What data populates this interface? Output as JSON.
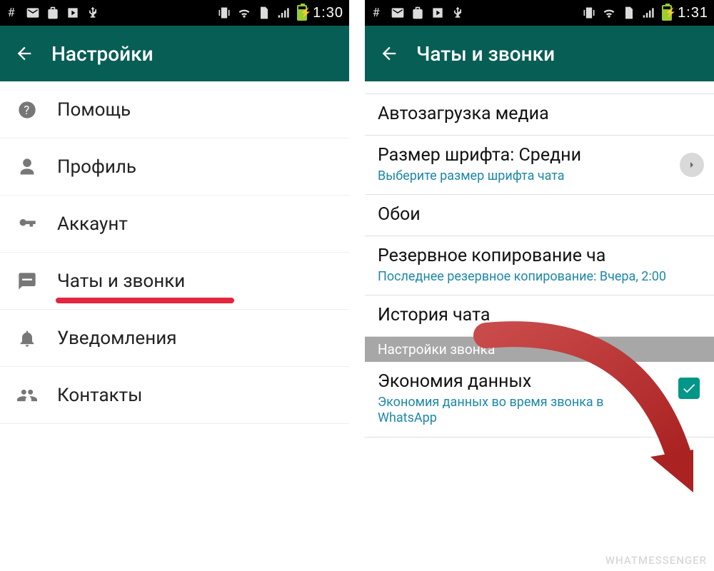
{
  "left": {
    "status": {
      "time": "1:30"
    },
    "appbar": {
      "title": "Настройки"
    },
    "items": [
      {
        "label": "Помощь"
      },
      {
        "label": "Профиль"
      },
      {
        "label": "Аккаунт"
      },
      {
        "label": "Чаты и звонки"
      },
      {
        "label": "Уведомления"
      },
      {
        "label": "Контакты"
      }
    ]
  },
  "right": {
    "status": {
      "time": "1:31"
    },
    "appbar": {
      "title": "Чаты и звонки"
    },
    "truncated_top": "",
    "items": {
      "media": {
        "title": "Автозагрузка медиа"
      },
      "font": {
        "title": "Размер шрифта: Средни",
        "sub": "Выберите размер шрифта чата"
      },
      "wall": {
        "title": "Обои"
      },
      "backup": {
        "title": "Резервное копирование ча",
        "sub": "Последнее резервное копирование: Вчера, 2:00"
      },
      "history": {
        "title": "История чата"
      }
    },
    "section": "Настройки звонка",
    "save": {
      "title": "Экономия данных",
      "sub": "Экономия данных во время звонка в WhatsApp",
      "checked": true
    }
  },
  "watermark": "WHATMESSENGER"
}
